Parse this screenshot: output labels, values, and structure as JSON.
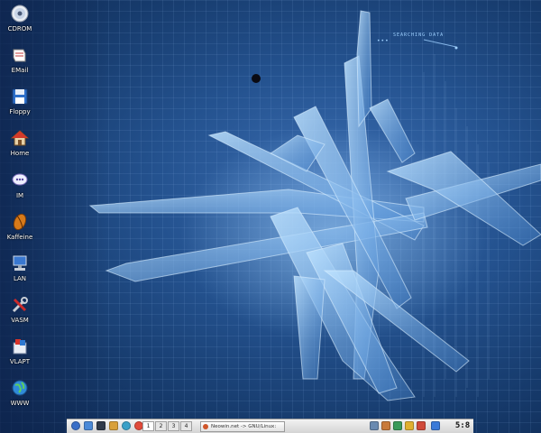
{
  "desktop": {
    "background_color": "#24528f",
    "overlay_label": "SEARCHING DATA",
    "overlay_dots": "•••",
    "icons": [
      {
        "label": "CDROM",
        "icon": "cdrom-icon"
      },
      {
        "label": "EMail",
        "icon": "email-icon"
      },
      {
        "label": "Floppy",
        "icon": "floppy-icon"
      },
      {
        "label": "Home",
        "icon": "home-icon"
      },
      {
        "label": "IM",
        "icon": "im-icon"
      },
      {
        "label": "Kaffeine",
        "icon": "kaffeine-icon"
      },
      {
        "label": "LAN",
        "icon": "lan-icon"
      },
      {
        "label": "VASM",
        "icon": "vasm-icon"
      },
      {
        "label": "VLAPT",
        "icon": "vlapt-icon"
      },
      {
        "label": "WWW",
        "icon": "www-icon"
      }
    ]
  },
  "taskbar": {
    "quick_launch": [
      "k-menu-icon",
      "browser-icon",
      "terminal-icon",
      "mail-icon",
      "network-icon",
      "lifesaver-icon"
    ],
    "pager": [
      "1",
      "2",
      "3",
      "4"
    ],
    "active_desktop": "1",
    "task_title": "Neowin.net -> GNU/Linux: ",
    "tray": [
      "tray-app-icon-1",
      "tray-app-icon-2",
      "tray-app-icon-3",
      "tray-app-icon-4",
      "tray-app-icon-5",
      "tray-app-icon-6"
    ],
    "clock": "5:8"
  }
}
